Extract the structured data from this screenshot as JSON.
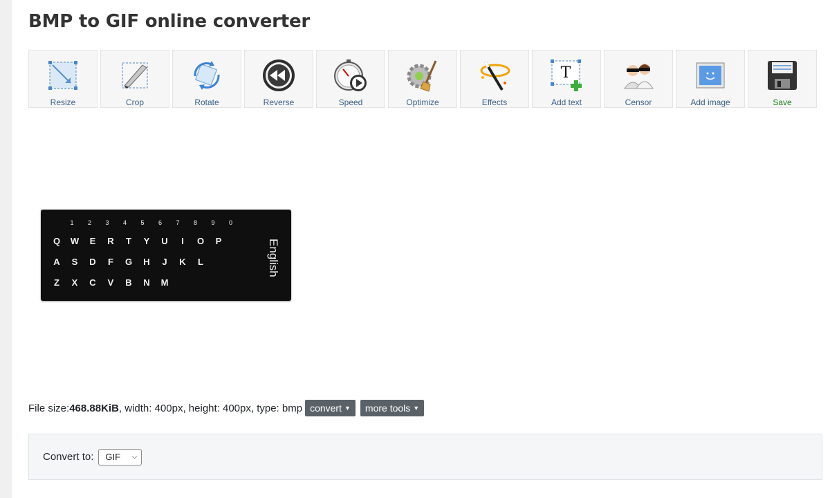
{
  "title": "BMP to GIF online converter",
  "tools": [
    {
      "name": "resize",
      "label": "Resize"
    },
    {
      "name": "crop",
      "label": "Crop"
    },
    {
      "name": "rotate",
      "label": "Rotate"
    },
    {
      "name": "reverse",
      "label": "Reverse"
    },
    {
      "name": "speed",
      "label": "Speed"
    },
    {
      "name": "optimize",
      "label": "Optimize"
    },
    {
      "name": "effects",
      "label": "Effects"
    },
    {
      "name": "add-text",
      "label": "Add text"
    },
    {
      "name": "censor",
      "label": "Censor"
    },
    {
      "name": "add-image",
      "label": "Add image"
    },
    {
      "name": "save",
      "label": "Save"
    }
  ],
  "preview": {
    "keyboard_label": "English",
    "rows": [
      [
        "Q",
        "W",
        "E",
        "R",
        "T",
        "Y",
        "U",
        "I",
        "O",
        "P"
      ],
      [
        "A",
        "S",
        "D",
        "F",
        "G",
        "H",
        "J",
        "K",
        "L"
      ],
      [
        "Z",
        "X",
        "C",
        "V",
        "B",
        "N",
        "M"
      ]
    ],
    "number_row": [
      "1",
      "2",
      "3",
      "4",
      "5",
      "6",
      "7",
      "8",
      "9",
      "0"
    ]
  },
  "fileinfo": {
    "size_label": "File size: ",
    "size_value": "468.88KiB",
    "rest": ", width: 400px, height: 400px, type: bmp",
    "convert_label": "convert",
    "more_tools_label": "more tools"
  },
  "convert": {
    "label": "Convert to:",
    "selected": "GIF"
  },
  "colors": {
    "tool_label": "#3a5f8a",
    "save_label": "#1b7d1b",
    "button_bg": "#5a6268"
  }
}
